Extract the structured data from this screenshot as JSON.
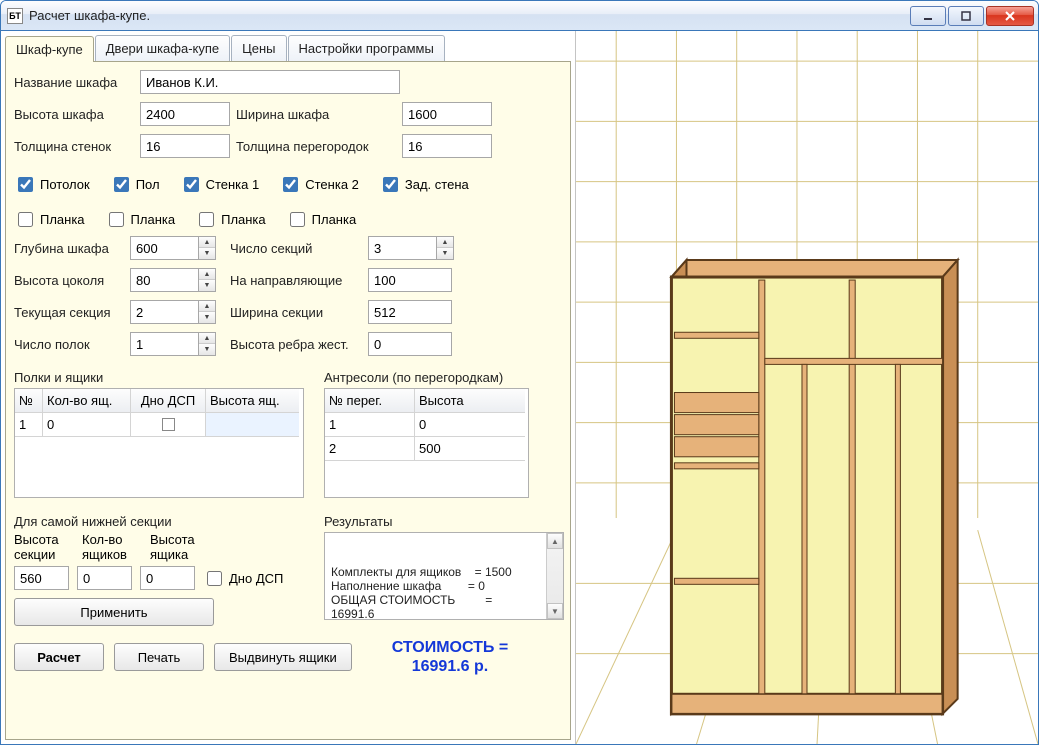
{
  "window": {
    "title": "Расчет шкафа-купе.",
    "app_icon_text": "БТ"
  },
  "tabs": [
    "Шкаф-купе",
    "Двери шкафа-купе",
    "Цены",
    "Настройки программы"
  ],
  "fields": {
    "name_label": "Название шкафа",
    "name_value": "Иванов К.И.",
    "height_label": "Высота шкафа",
    "height_value": "2400",
    "width_label": "Ширина шкафа",
    "width_value": "1600",
    "wall_thick_label": "Толщина стенок",
    "wall_thick_value": "16",
    "part_thick_label": "Толщина перегородок",
    "part_thick_value": "16",
    "depth_label": "Глубина шкафа",
    "depth_value": "600",
    "sections_label": "Число секций",
    "sections_value": "3",
    "plinth_h_label": "Высота цоколя",
    "plinth_h_value": "80",
    "rails_label": "На направляющие",
    "rails_value": "100",
    "cur_section_label": "Текущая секция",
    "cur_section_value": "2",
    "section_w_label": "Ширина секции",
    "section_w_value": "512",
    "shelves_n_label": "Число полок",
    "shelves_n_value": "1",
    "rib_h_label": "Высота ребра жест.",
    "rib_h_value": "0"
  },
  "checks1": [
    {
      "label": "Потолок",
      "checked": true
    },
    {
      "label": "Пол",
      "checked": true
    },
    {
      "label": "Стенка 1",
      "checked": true
    },
    {
      "label": "Стенка 2",
      "checked": true
    },
    {
      "label": "Зад. стена",
      "checked": true
    }
  ],
  "checks2": [
    {
      "label": "Планка",
      "checked": false
    },
    {
      "label": "Планка",
      "checked": false
    },
    {
      "label": "Планка",
      "checked": false
    },
    {
      "label": "Планка",
      "checked": false
    }
  ],
  "shelves_group_label": "Полки и ящики",
  "shelves_table": {
    "headers": [
      "№",
      "Кол-во ящ.",
      "Дно ДСП",
      "Высота ящ."
    ],
    "rows": [
      {
        "n": "1",
        "count": "0",
        "dno": false,
        "height": ""
      }
    ]
  },
  "antresol_group_label": "Антресоли (по перегородкам)",
  "antresol_table": {
    "headers": [
      "№ перег.",
      "Высота"
    ],
    "rows": [
      {
        "n": "1",
        "h": "0"
      },
      {
        "n": "2",
        "h": "500"
      }
    ]
  },
  "lower": {
    "group_label": "Для самой нижней секции",
    "col_labels": [
      "Высота секции",
      "Кол-во ящиков",
      "Высота ящика"
    ],
    "sec_h": "560",
    "drawer_n": "0",
    "drawer_h": "0",
    "dno_label": "Дно ДСП",
    "dno_checked": false,
    "apply_btn": "Применить"
  },
  "results": {
    "label": "Результаты",
    "lines": [
      "Комплекты для ящиков    = 1500",
      "Наполнение шкафа        = 0",
      "ОБЩАЯ СТОИМОСТЬ         =",
      "16991.6"
    ]
  },
  "buttons": {
    "calc": "Расчет",
    "print": "Печать",
    "eject": "Выдвинуть ящики"
  },
  "cost": {
    "label": "СТОИМОСТЬ =",
    "value": "16991.6 р."
  }
}
